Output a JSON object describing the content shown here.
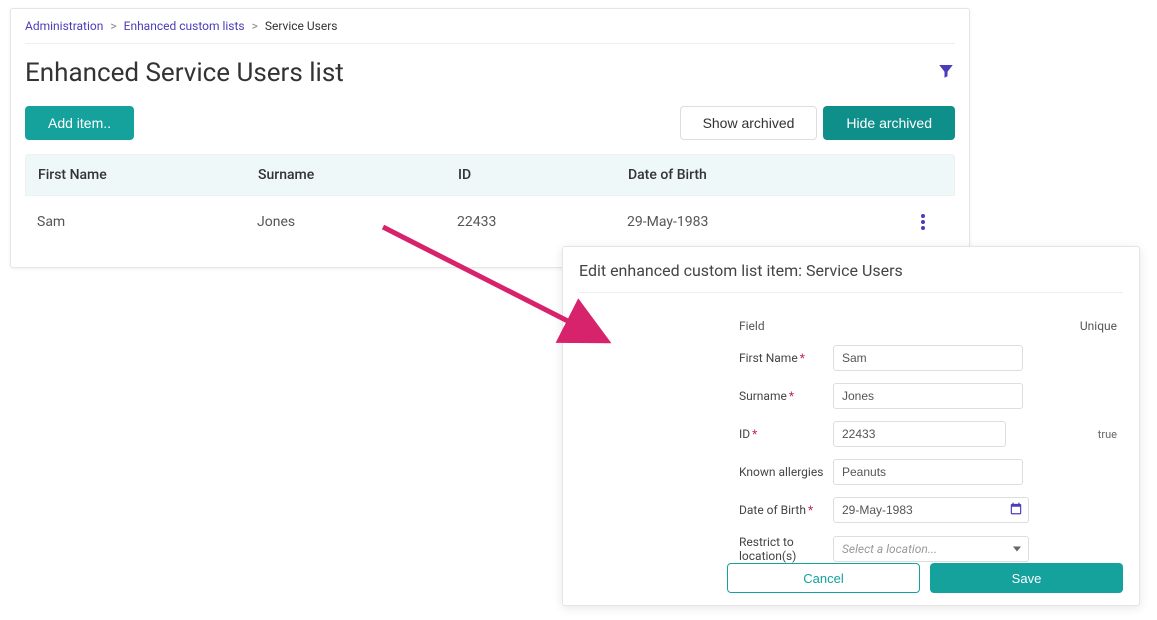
{
  "breadcrumb": {
    "a": "Administration",
    "b": "Enhanced custom lists",
    "c": "Service Users"
  },
  "page": {
    "title": "Enhanced Service Users list"
  },
  "toolbar": {
    "add": "Add item..",
    "show_archived": "Show archived",
    "hide_archived": "Hide archived"
  },
  "table": {
    "headers": {
      "fn": "First Name",
      "sn": "Surname",
      "id": "ID",
      "dob": "Date of Birth"
    },
    "rows": [
      {
        "fn": "Sam",
        "sn": "Jones",
        "id": "22433",
        "dob": "29-May-1983"
      }
    ]
  },
  "dialog": {
    "title": "Edit enhanced custom list item: Service Users",
    "head_field": "Field",
    "head_unique": "Unique",
    "labels": {
      "first_name": "First Name",
      "surname": "Surname",
      "id": "ID",
      "allergies": "Known allergies",
      "dob": "Date of Birth",
      "restrict": "Restrict to location(s)"
    },
    "values": {
      "first_name": "Sam",
      "surname": "Jones",
      "id": "22433",
      "allergies": "Peanuts",
      "dob": "29-May-1983",
      "restrict_placeholder": "Select a location..."
    },
    "unique_id": "true",
    "buttons": {
      "cancel": "Cancel",
      "save": "Save"
    }
  }
}
